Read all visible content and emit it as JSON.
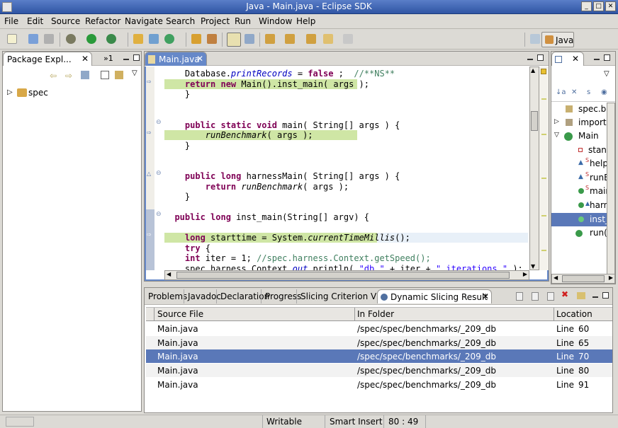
{
  "window": {
    "title": "Java - Main.java - Eclipse SDK"
  },
  "menu": [
    "File",
    "Edit",
    "Source",
    "Refactor",
    "Navigate",
    "Search",
    "Project",
    "Run",
    "Window",
    "Help"
  ],
  "perspective": {
    "label": "Java"
  },
  "package_explorer": {
    "tab_label": "Package Expl...",
    "overflow_label": "»1",
    "tree": [
      {
        "label": "spec"
      }
    ]
  },
  "editor": {
    "tab_label": "Main.java",
    "lines": [
      [
        [
          "",
          "    Database."
        ],
        [
          "fld",
          "printRecords"
        ],
        [
          "",
          " = "
        ],
        [
          "kw",
          "false"
        ],
        [
          "",
          " ;  "
        ],
        [
          "cm",
          "//**NS**"
        ]
      ],
      [
        [
          "kw",
          "    return new"
        ],
        [
          "",
          " Main().inst_main( args );"
        ]
      ],
      [
        [
          "",
          "    }"
        ]
      ],
      [
        [
          "",
          ""
        ]
      ],
      [
        [
          "",
          ""
        ]
      ],
      [
        [
          "kw",
          "    public static void"
        ],
        [
          "",
          " main( String[] args ) {"
        ]
      ],
      [
        [
          "it",
          "        runBenchmark"
        ],
        [
          "",
          "( args );"
        ]
      ],
      [
        [
          "",
          "    }"
        ]
      ],
      [
        [
          "",
          ""
        ]
      ],
      [
        [
          "",
          ""
        ]
      ],
      [
        [
          "kw",
          "    public long"
        ],
        [
          "",
          " harnessMain( String[] args ) {"
        ]
      ],
      [
        [
          "kw",
          "        return"
        ],
        [
          "",
          " "
        ],
        [
          "it",
          "runBenchmark"
        ],
        [
          "",
          "( args );"
        ]
      ],
      [
        [
          "",
          "    }"
        ]
      ],
      [
        [
          "",
          ""
        ]
      ],
      [
        [
          "kw",
          "  public long"
        ],
        [
          "",
          " inst_main(String[] argv) {"
        ]
      ],
      [
        [
          "",
          ""
        ]
      ],
      [
        [
          "kw",
          "    long"
        ],
        [
          "",
          " starttime = System."
        ],
        [
          "it",
          "currentTimeMillis"
        ],
        [
          "",
          "();"
        ]
      ],
      [
        [
          "kw",
          "    try"
        ],
        [
          "",
          " {"
        ]
      ],
      [
        [
          "kw",
          "    int"
        ],
        [
          "",
          " iter = 1; "
        ],
        [
          "cm",
          "//spec.harness.Context.getSpeed();"
        ]
      ],
      [
        [
          "",
          "    spec.harness.Context."
        ],
        [
          "fld",
          "out"
        ],
        [
          "",
          ".println( "
        ],
        [
          "str",
          "\"db \""
        ],
        [
          "",
          " + iter + "
        ],
        [
          "str",
          "\" iterations \""
        ],
        [
          "",
          " );"
        ]
      ]
    ]
  },
  "outline": {
    "items": [
      {
        "label": "spec.benc"
      },
      {
        "label": "import dec"
      },
      {
        "label": "Main"
      },
      {
        "label": "standa"
      },
      {
        "label": "help()"
      },
      {
        "label": "runBen"
      },
      {
        "label": "main(S"
      },
      {
        "label": "harnes"
      },
      {
        "label": "inst_m"
      },
      {
        "label": "run(Str"
      }
    ]
  },
  "bottom_tabs": [
    "Problems",
    "Javadoc",
    "Declaration",
    "Progress",
    "Slicing Criterion View",
    "Dynamic Slicing Result"
  ],
  "results": {
    "columns": [
      "Source File",
      "In Folder",
      "Location"
    ],
    "rows": [
      {
        "file": "Main.java",
        "folder": "/spec/spec/benchmarks/_209_db",
        "loc_word": "Line",
        "loc_num": "60"
      },
      {
        "file": "Main.java",
        "folder": "/spec/spec/benchmarks/_209_db",
        "loc_word": "Line",
        "loc_num": "65"
      },
      {
        "file": "Main.java",
        "folder": "/spec/spec/benchmarks/_209_db",
        "loc_word": "Line",
        "loc_num": "70"
      },
      {
        "file": "Main.java",
        "folder": "/spec/spec/benchmarks/_209_db",
        "loc_word": "Line",
        "loc_num": "80"
      },
      {
        "file": "Main.java",
        "folder": "/spec/spec/benchmarks/_209_db",
        "loc_word": "Line",
        "loc_num": "91"
      }
    ]
  },
  "status": {
    "writable": "Writable",
    "insert_mode": "Smart Insert",
    "position": "80 : 49"
  },
  "colors": {
    "selection": "#5a78b8",
    "highlight": "#cfe6a5",
    "accent": "#2f55a4"
  }
}
